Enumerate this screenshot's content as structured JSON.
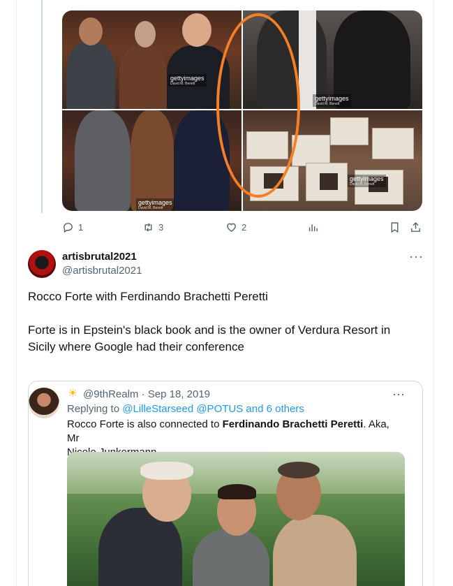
{
  "top_tweet": {
    "photos": [
      {
        "alt": "photo-1",
        "watermark": "gettyimages",
        "credit": "David M. Benett"
      },
      {
        "alt": "photo-2",
        "watermark": "gettyimages",
        "credit": "David M. Benett"
      },
      {
        "alt": "photo-3",
        "watermark": "gettyimages",
        "credit": "David M. Benett"
      },
      {
        "alt": "photo-4",
        "watermark": "gettyimages",
        "credit": "David M. Benett"
      }
    ],
    "highlight_color": "#f57f26",
    "actions": {
      "reply_count": "1",
      "retweet_count": "3",
      "like_count": "2"
    }
  },
  "tweet": {
    "display_name": "artisbrutal2021",
    "handle": "@artisbrutal2021",
    "more": "···",
    "text_paragraph_1": "Rocco Forte with Ferdinando Brachetti Peretti",
    "text_paragraph_2_line_1": "Forte is in Epstein's black book and is the owner of Verdura Resort in",
    "text_paragraph_2_line_2": "Sicily where Google had their conference"
  },
  "quoted_tweet": {
    "handle": "@9thRealm",
    "separator": "·",
    "date": "Sep 18, 2019",
    "more": "···",
    "replying_to_label": "Replying to",
    "replying_to_users": "@LilleStarseed @POTUS and 6 others",
    "text_1": "Rocco Forte is also connected to ",
    "text_bold": "Ferdinando Brachetti Peretti",
    "text_2": ". Aka, Mr",
    "text_line_2": "Nicole Junkermann."
  },
  "colors": {
    "link": "#1d9bf0",
    "muted": "#536471",
    "text": "#0f1419",
    "border": "#cfd9de"
  }
}
